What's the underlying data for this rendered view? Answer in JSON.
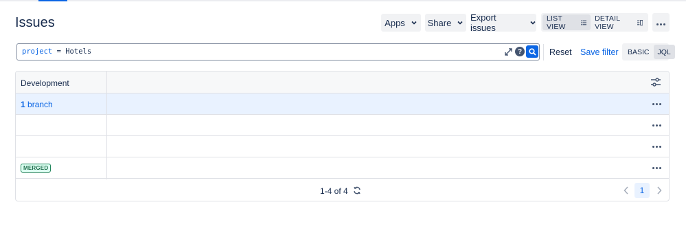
{
  "page": {
    "title": "Issues"
  },
  "toolbar": {
    "apps_label": "Apps",
    "share_label": "Share",
    "export_label": "Export issues",
    "list_view_label": "LIST VIEW",
    "detail_view_label": "DETAIL VIEW",
    "active_view": "list"
  },
  "search": {
    "query_keyword": "project",
    "query_rest": " = Hotels",
    "reset_label": "Reset",
    "save_filter_label": "Save filter",
    "mode_basic_label": "BASIC",
    "mode_jql_label": "JQL",
    "active_mode": "JQL"
  },
  "table": {
    "columns": [
      "Development"
    ],
    "rows": [
      {
        "dev_count": "1",
        "dev_text": " branch",
        "selected": true
      },
      {
        "dev_count": "",
        "dev_text": "",
        "selected": false
      },
      {
        "dev_count": "",
        "dev_text": "",
        "selected": false
      },
      {
        "badge": "MERGED",
        "selected": false
      }
    ]
  },
  "pagination": {
    "count_text": "1-4 of 4",
    "current_page": "1"
  },
  "colors": {
    "accent": "#0c66e4",
    "selected_row": "#e9f2ff",
    "merged_badge": "#1f845a"
  }
}
